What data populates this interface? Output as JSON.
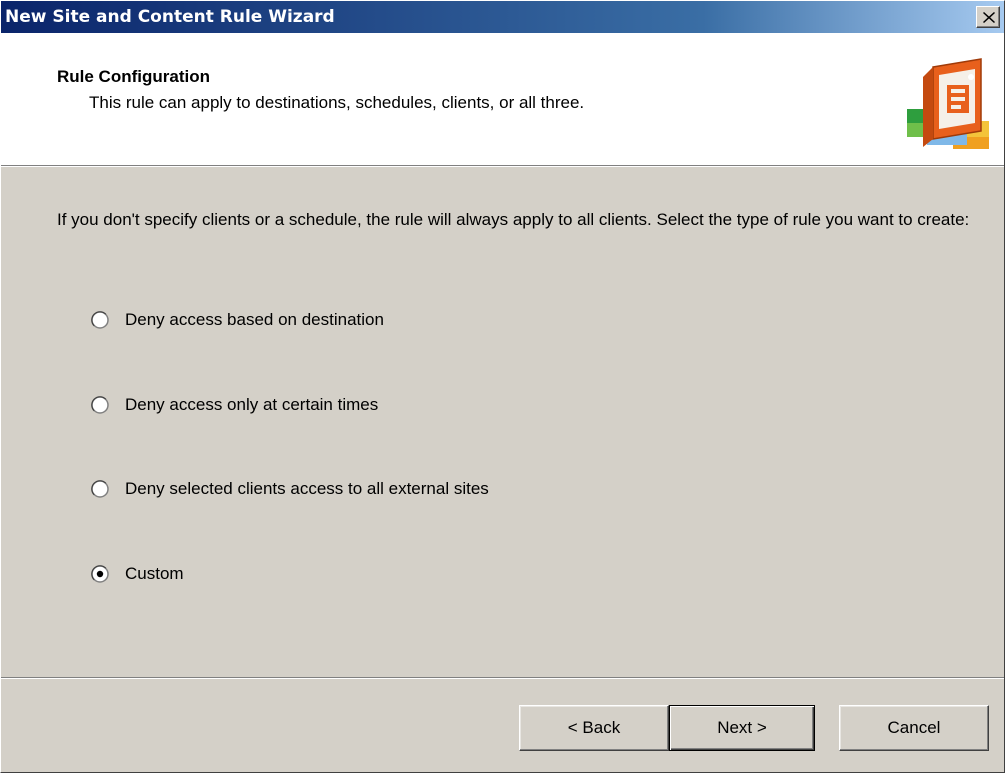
{
  "window": {
    "title": "New Site and Content Rule Wizard",
    "close_icon": "close-icon"
  },
  "header": {
    "title": "Rule Configuration",
    "subtitle": "This rule can apply to destinations, schedules, clients, or all three.",
    "icon": "wizard-rule-icon"
  },
  "main": {
    "instructions": "If you don't specify clients or a schedule, the rule will always apply to all clients. Select the type of rule you want to create:",
    "options": [
      {
        "label": "Deny access based on destination",
        "selected": false
      },
      {
        "label": "Deny access only at certain times",
        "selected": false
      },
      {
        "label": "Deny selected clients access to all external sites",
        "selected": false
      },
      {
        "label": "Custom",
        "selected": true
      }
    ]
  },
  "footer": {
    "back_label": "< Back",
    "next_label": "Next >",
    "cancel_label": "Cancel"
  },
  "colors": {
    "dialog_face": "#d4d0c8",
    "title_start": "#0a246a",
    "title_end": "#a6caf0"
  }
}
